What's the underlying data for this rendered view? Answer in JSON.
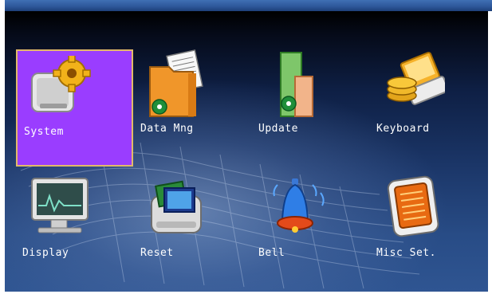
{
  "menu": {
    "items": [
      {
        "label": "System",
        "icon": "system-gear-icon",
        "selected": true
      },
      {
        "label": "Data Mng",
        "icon": "data-management-icon",
        "selected": false
      },
      {
        "label": "Update",
        "icon": "update-icon",
        "selected": false
      },
      {
        "label": "Keyboard",
        "icon": "keyboard-icon",
        "selected": false
      },
      {
        "label": "Display",
        "icon": "display-monitor-icon",
        "selected": false
      },
      {
        "label": "Reset",
        "icon": "reset-icon",
        "selected": false
      },
      {
        "label": "Bell",
        "icon": "bell-icon",
        "selected": false
      },
      {
        "label": "Misc Set.",
        "icon": "misc-settings-icon",
        "selected": false
      }
    ]
  },
  "colors": {
    "selected_background": "#9a3dff",
    "selected_border": "#e2b96a",
    "label_text": "#ffffff",
    "screen_top": "#000000",
    "screen_bottom": "#2f5592"
  }
}
